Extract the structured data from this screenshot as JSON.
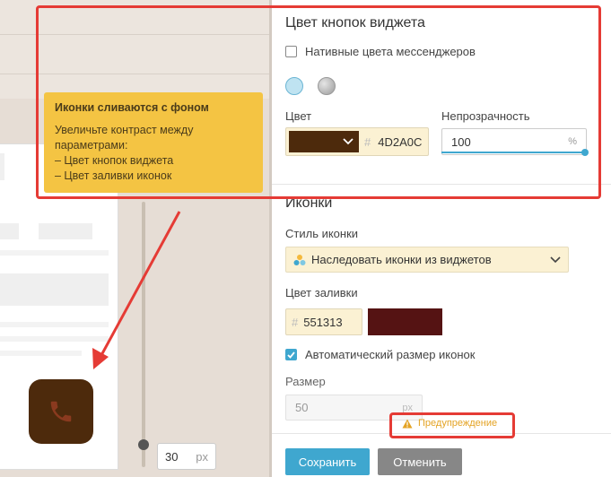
{
  "preview": {
    "size_value": "30",
    "size_unit": "px",
    "call_button_icon": "phone-icon",
    "call_button_color": "#4d2a0c"
  },
  "tooltip": {
    "title": "Иконки сливаются с фоном",
    "line1": "Увеличьте контраст между",
    "line2": "параметрами:",
    "line3": "– Цвет кнопок виджета",
    "line4": "– Цвет заливки иконок"
  },
  "button_colors": {
    "title": "Цвет кнопок виджета",
    "native_colors_label": "Нативные цвета мессенджеров",
    "native_colors_checked": false,
    "color_label": "Цвет",
    "color_hex": "4D2A0C",
    "color_value": "#4d2a0c",
    "opacity_label": "Непрозрачность",
    "opacity_value": "100",
    "opacity_unit": "%"
  },
  "icons": {
    "title": "Иконки",
    "style_label": "Стиль иконки",
    "style_value": "Наследовать иконки из виджетов",
    "fill_label": "Цвет заливки",
    "fill_hex": "551313",
    "fill_value": "#551313",
    "auto_size_label": "Автоматический размер иконок",
    "auto_size_checked": true,
    "size_label": "Размер",
    "size_value": "50",
    "size_unit": "px"
  },
  "warning": {
    "text": "Предупреждение",
    "icon": "warning-triangle-icon"
  },
  "actions": {
    "save_label": "Сохранить",
    "cancel_label": "Отменить"
  },
  "colors": {
    "accent": "#3fa7cf",
    "highlight_red": "#e53b35",
    "tooltip_bg": "#f4c443",
    "warning_orange": "#e4a324"
  }
}
